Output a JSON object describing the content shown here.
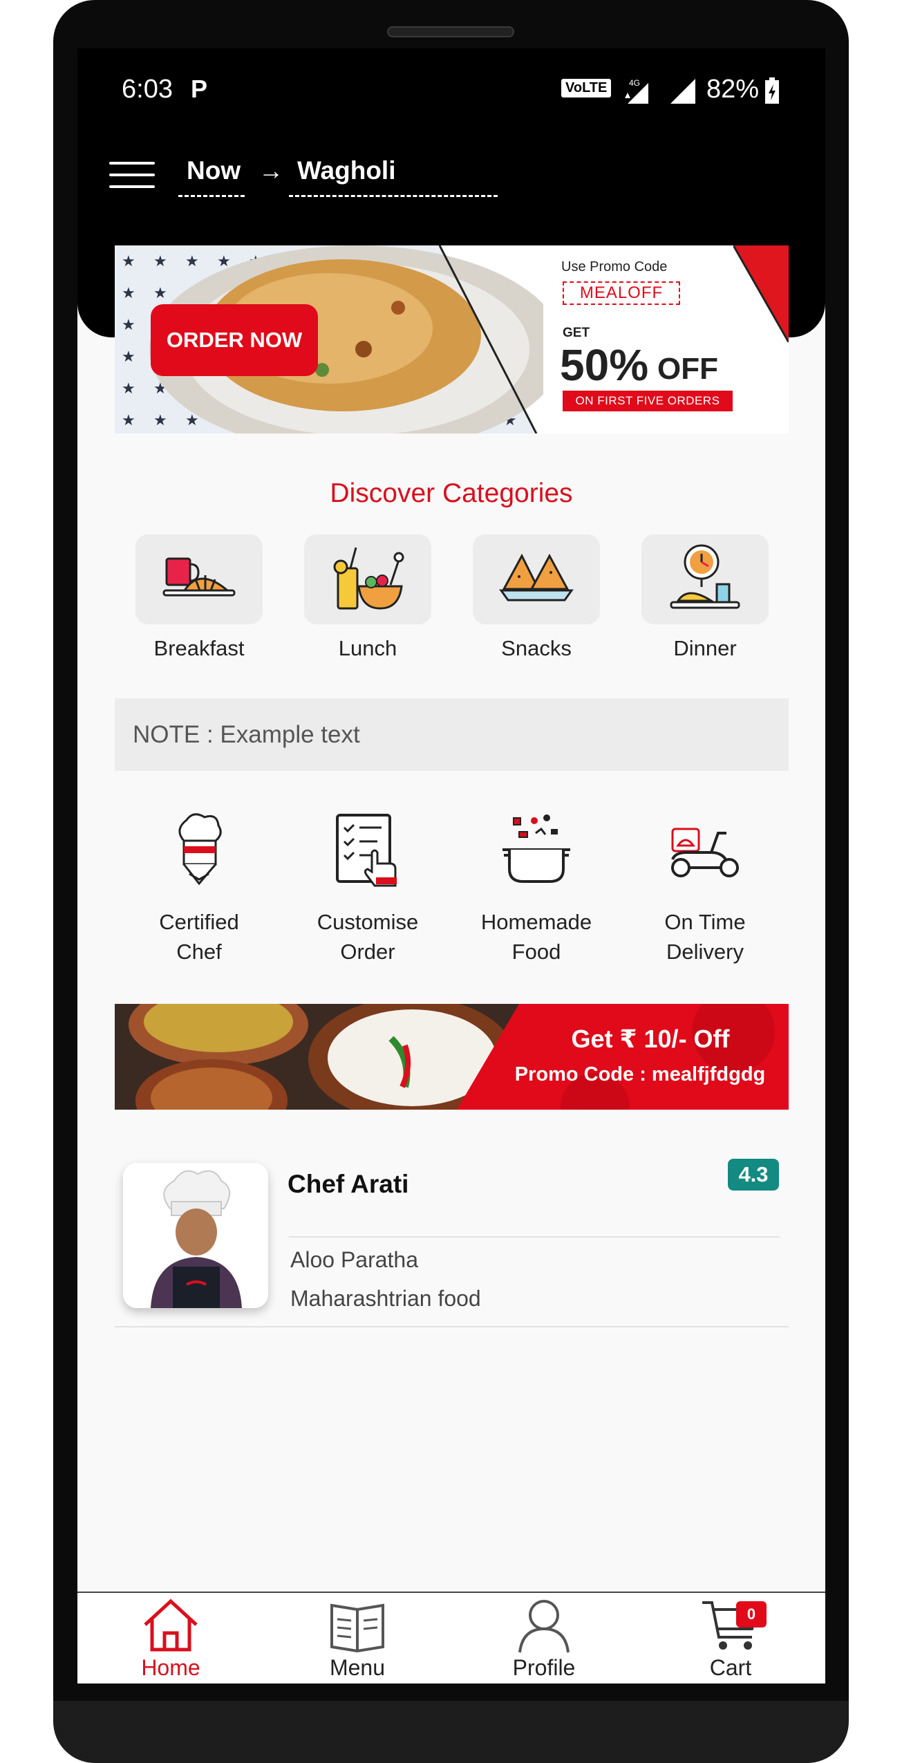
{
  "status_bar": {
    "time": "6:03",
    "notification_glyph": "P",
    "volte": "VoLTE",
    "network": "4G",
    "battery_percent": "82%"
  },
  "toolbar": {
    "when": "Now",
    "arrow": "→",
    "location": "Wagholi"
  },
  "promo_banner": {
    "button_label": "ORDER NOW",
    "use_code_label": "Use Promo Code",
    "promo_code": "MEALOFF",
    "get_label": "GET",
    "discount": "50%",
    "off_label": "OFF",
    "condition": "ON FIRST FIVE ORDERS"
  },
  "categories": {
    "title": "Discover Categories",
    "items": [
      {
        "label": "Breakfast",
        "icon": "breakfast-icon"
      },
      {
        "label": "Lunch",
        "icon": "lunch-icon"
      },
      {
        "label": "Snacks",
        "icon": "snacks-icon"
      },
      {
        "label": "Dinner",
        "icon": "dinner-icon"
      }
    ]
  },
  "note": "NOTE : Example text",
  "features": [
    {
      "line1": "Certified",
      "line2": "Chef",
      "icon": "chef-hat-icon"
    },
    {
      "line1": "Customise",
      "line2": "Order",
      "icon": "checklist-icon"
    },
    {
      "line1": "Homemade",
      "line2": "Food",
      "icon": "cooking-pot-icon"
    },
    {
      "line1": "On Time",
      "line2": "Delivery",
      "icon": "delivery-scooter-icon"
    }
  ],
  "offer_banner": {
    "line1": "Get ₹ 10/- Off",
    "line2": "Promo Code : mealfjfdgdg"
  },
  "chef": {
    "name": "Chef Arati",
    "rating": "4.3",
    "dish": "Aloo Paratha",
    "cuisine": "Maharashtrian food"
  },
  "bottom_nav": {
    "items": [
      {
        "label": "Home",
        "icon": "home-icon",
        "active": true
      },
      {
        "label": "Menu",
        "icon": "menu-book-icon",
        "active": false
      },
      {
        "label": "Profile",
        "icon": "profile-icon",
        "active": false
      },
      {
        "label": "Cart",
        "icon": "cart-icon",
        "active": false
      }
    ],
    "cart_count": "0"
  },
  "colors": {
    "accent_red": "#e00a1a",
    "title_red": "#d90f1d",
    "rating_teal": "#138a82",
    "header_black": "#000000",
    "screen_bg": "#f9f9f9"
  }
}
